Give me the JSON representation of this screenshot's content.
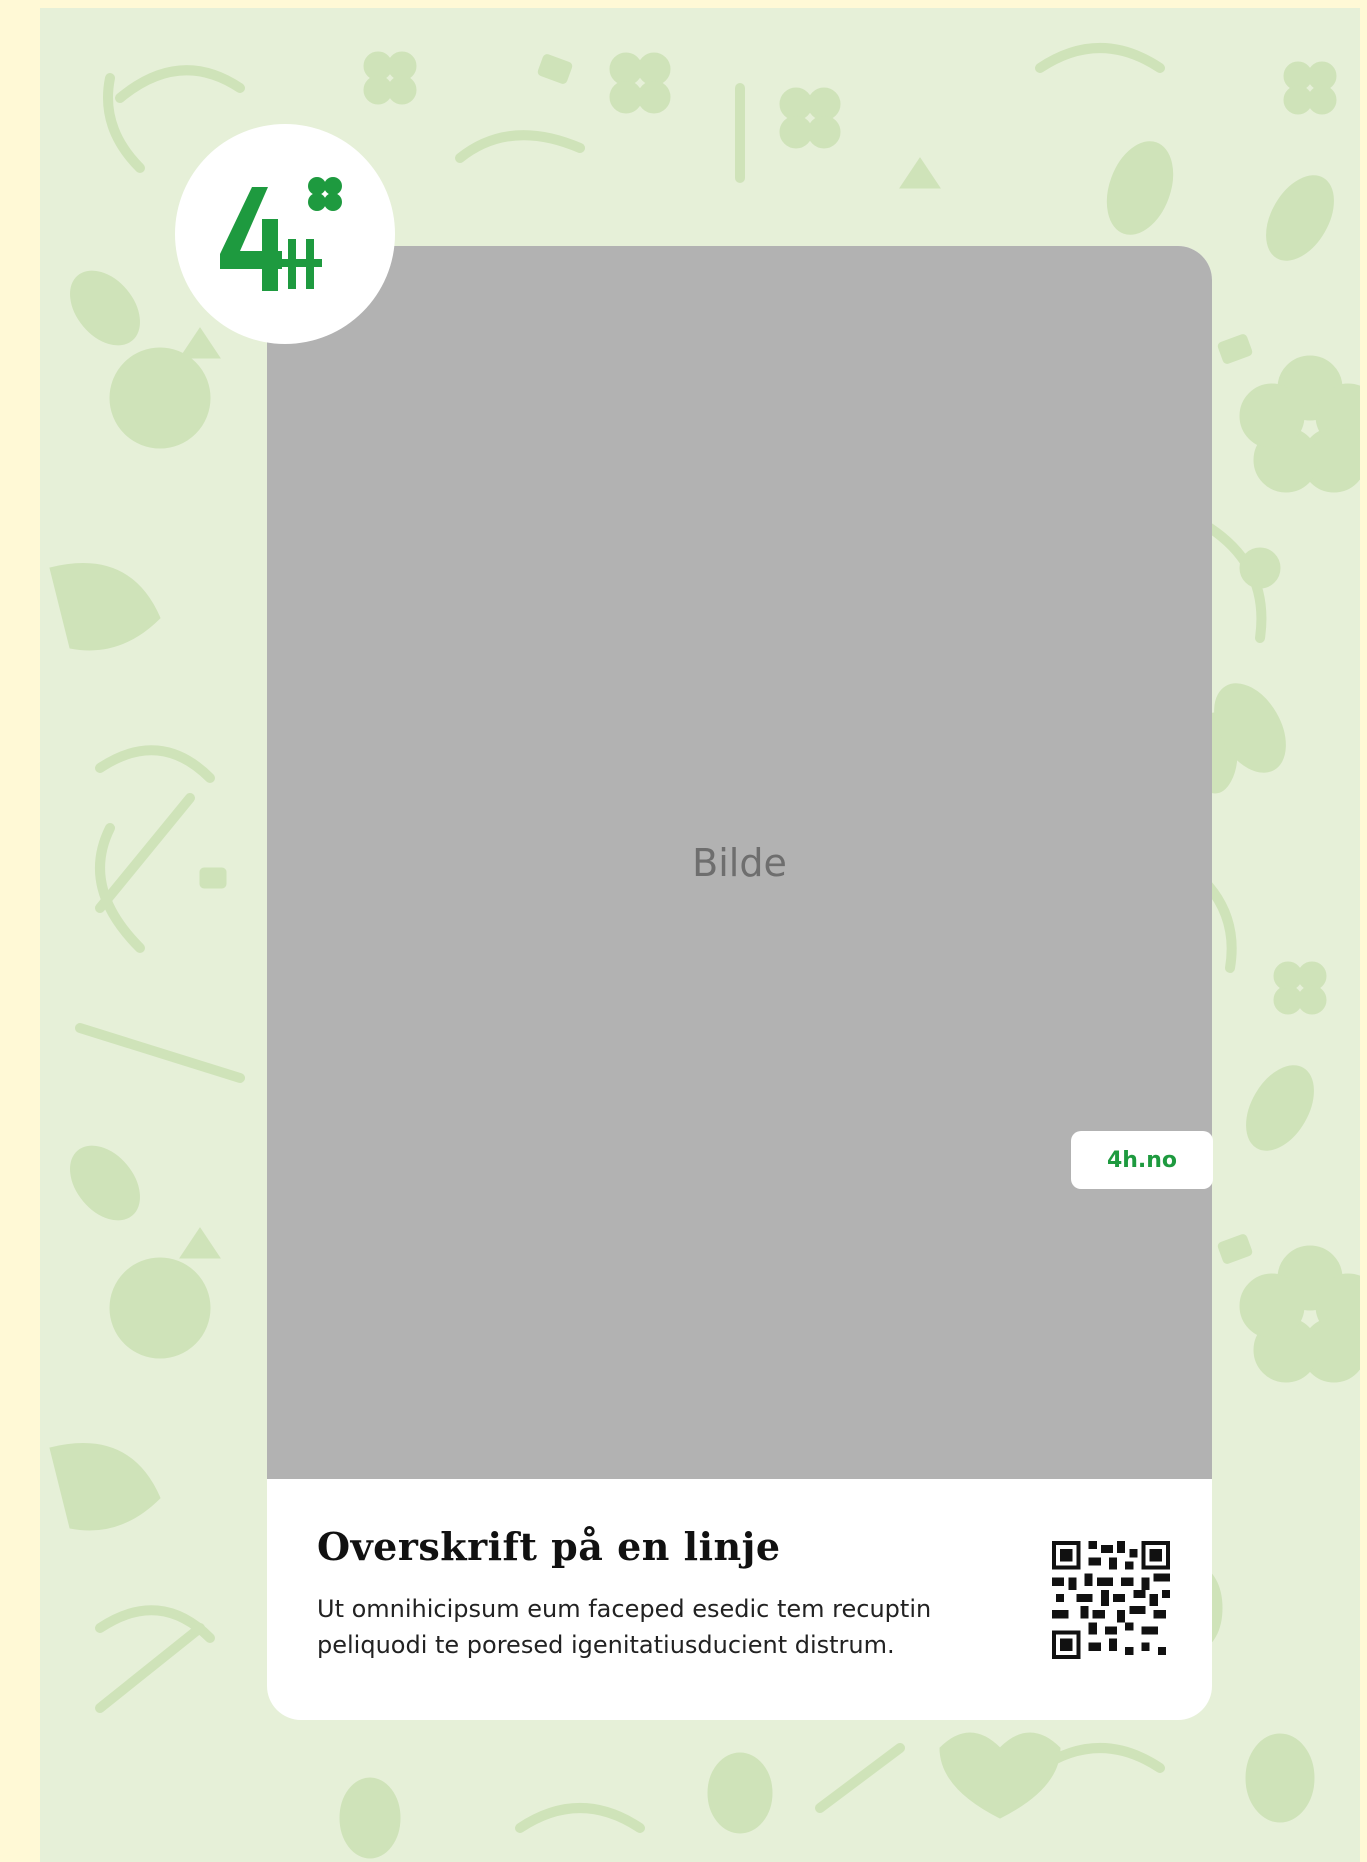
{
  "logo": {
    "text": "4H",
    "accent_color": "#1e9a3f"
  },
  "card": {
    "image_placeholder": "Bilde",
    "url_badge": "4h.no",
    "heading": "Overskrift på en linje",
    "body": "Ut omnihicipsum eum faceped esedic tem recuptin peliquodi te poresed igenitatiusducient distrum."
  },
  "colors": {
    "background_pattern": "#e6f0d8",
    "pattern_shapes": "#cfe3b9",
    "image_placeholder": "#b2b2b2",
    "outer_border": "#fff9d6"
  }
}
